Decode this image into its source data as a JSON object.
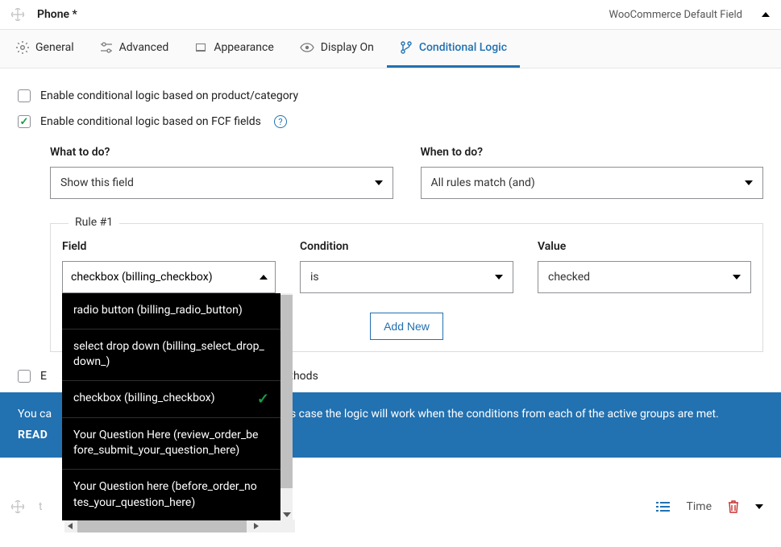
{
  "header": {
    "title": "Phone *",
    "subtitle": "WooCommerce Default Field"
  },
  "tabs": [
    {
      "label": "General"
    },
    {
      "label": "Advanced"
    },
    {
      "label": "Appearance"
    },
    {
      "label": "Display On"
    },
    {
      "label": "Conditional Logic"
    }
  ],
  "toggles": {
    "product_category": "Enable conditional logic based on product/category",
    "fcf_fields": "Enable conditional logic based on FCF fields"
  },
  "form": {
    "what_label": "What to do?",
    "what_value": "Show this field",
    "when_label": "When to do?",
    "when_value": "All rules match (and)"
  },
  "rule": {
    "legend": "Rule #1",
    "field_label": "Field",
    "field_input": "checkbox (billing_checkbox)",
    "condition_label": "Condition",
    "condition_value": "is",
    "value_label": "Value",
    "value_value": "checked"
  },
  "dropdown": [
    "radio button (billing_radio_button)",
    "select drop down (billing_select_drop_down_)",
    "checkbox (billing_checkbox)",
    "Your Question Here (review_order_before_submit_your_question_here)",
    "Your Question here (before_order_notes_your_question_here)"
  ],
  "add_new": "Add New",
  "shipping_toggle_fragment": "ethods",
  "shipping_toggle_prefix": "E",
  "banner": {
    "line_fragment": "n this case the logic will work when the conditions from each of the active groups are met.",
    "line_prefix": "You ca",
    "read_more": "READ"
  },
  "bottom": {
    "time_label": "Time",
    "t_label": "t"
  }
}
